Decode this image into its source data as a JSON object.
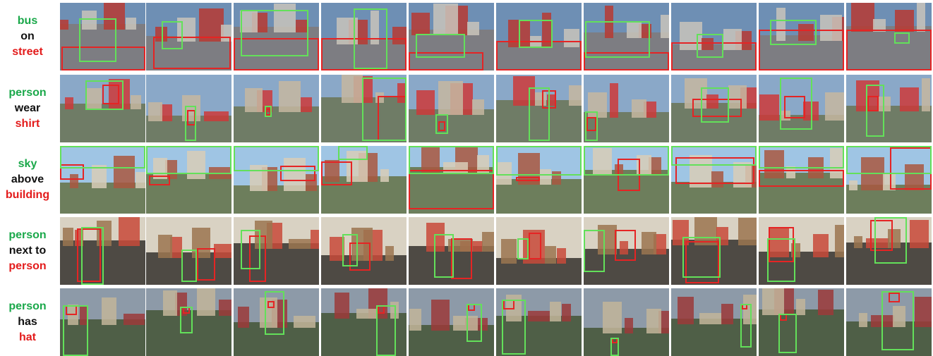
{
  "legend": {
    "subject_color": "#1aa84a",
    "object_color": "#e31b1b",
    "subject_box_color": "#63e05a",
    "object_box_color": "#e52424"
  },
  "rows": [
    {
      "subject": "bus",
      "predicate": "on",
      "object": "street",
      "scene": "street",
      "palette": [
        "#6e8fb4",
        "#c9c4bb",
        "#7d7d82",
        "#b73a32"
      ]
    },
    {
      "subject": "person",
      "predicate": "wear",
      "object": "shirt",
      "scene": "people",
      "palette": [
        "#8aa8c8",
        "#c6b7a0",
        "#6f7c66",
        "#cc3a3a"
      ]
    },
    {
      "subject": "sky",
      "predicate": "above",
      "object": "building",
      "scene": "sky",
      "palette": [
        "#9fc5e4",
        "#d8cdb7",
        "#6d7e5c",
        "#a9573f"
      ]
    },
    {
      "subject": "person",
      "predicate": "next to",
      "object": "person",
      "scene": "indoor",
      "palette": [
        "#d9d2c3",
        "#9b7650",
        "#4e4a44",
        "#c84a3a"
      ]
    },
    {
      "subject": "person",
      "predicate": "has",
      "object": "hat",
      "scene": "outdoor",
      "palette": [
        "#8d9aa8",
        "#c2b59a",
        "#4f5f47",
        "#9b3a3a"
      ]
    }
  ]
}
